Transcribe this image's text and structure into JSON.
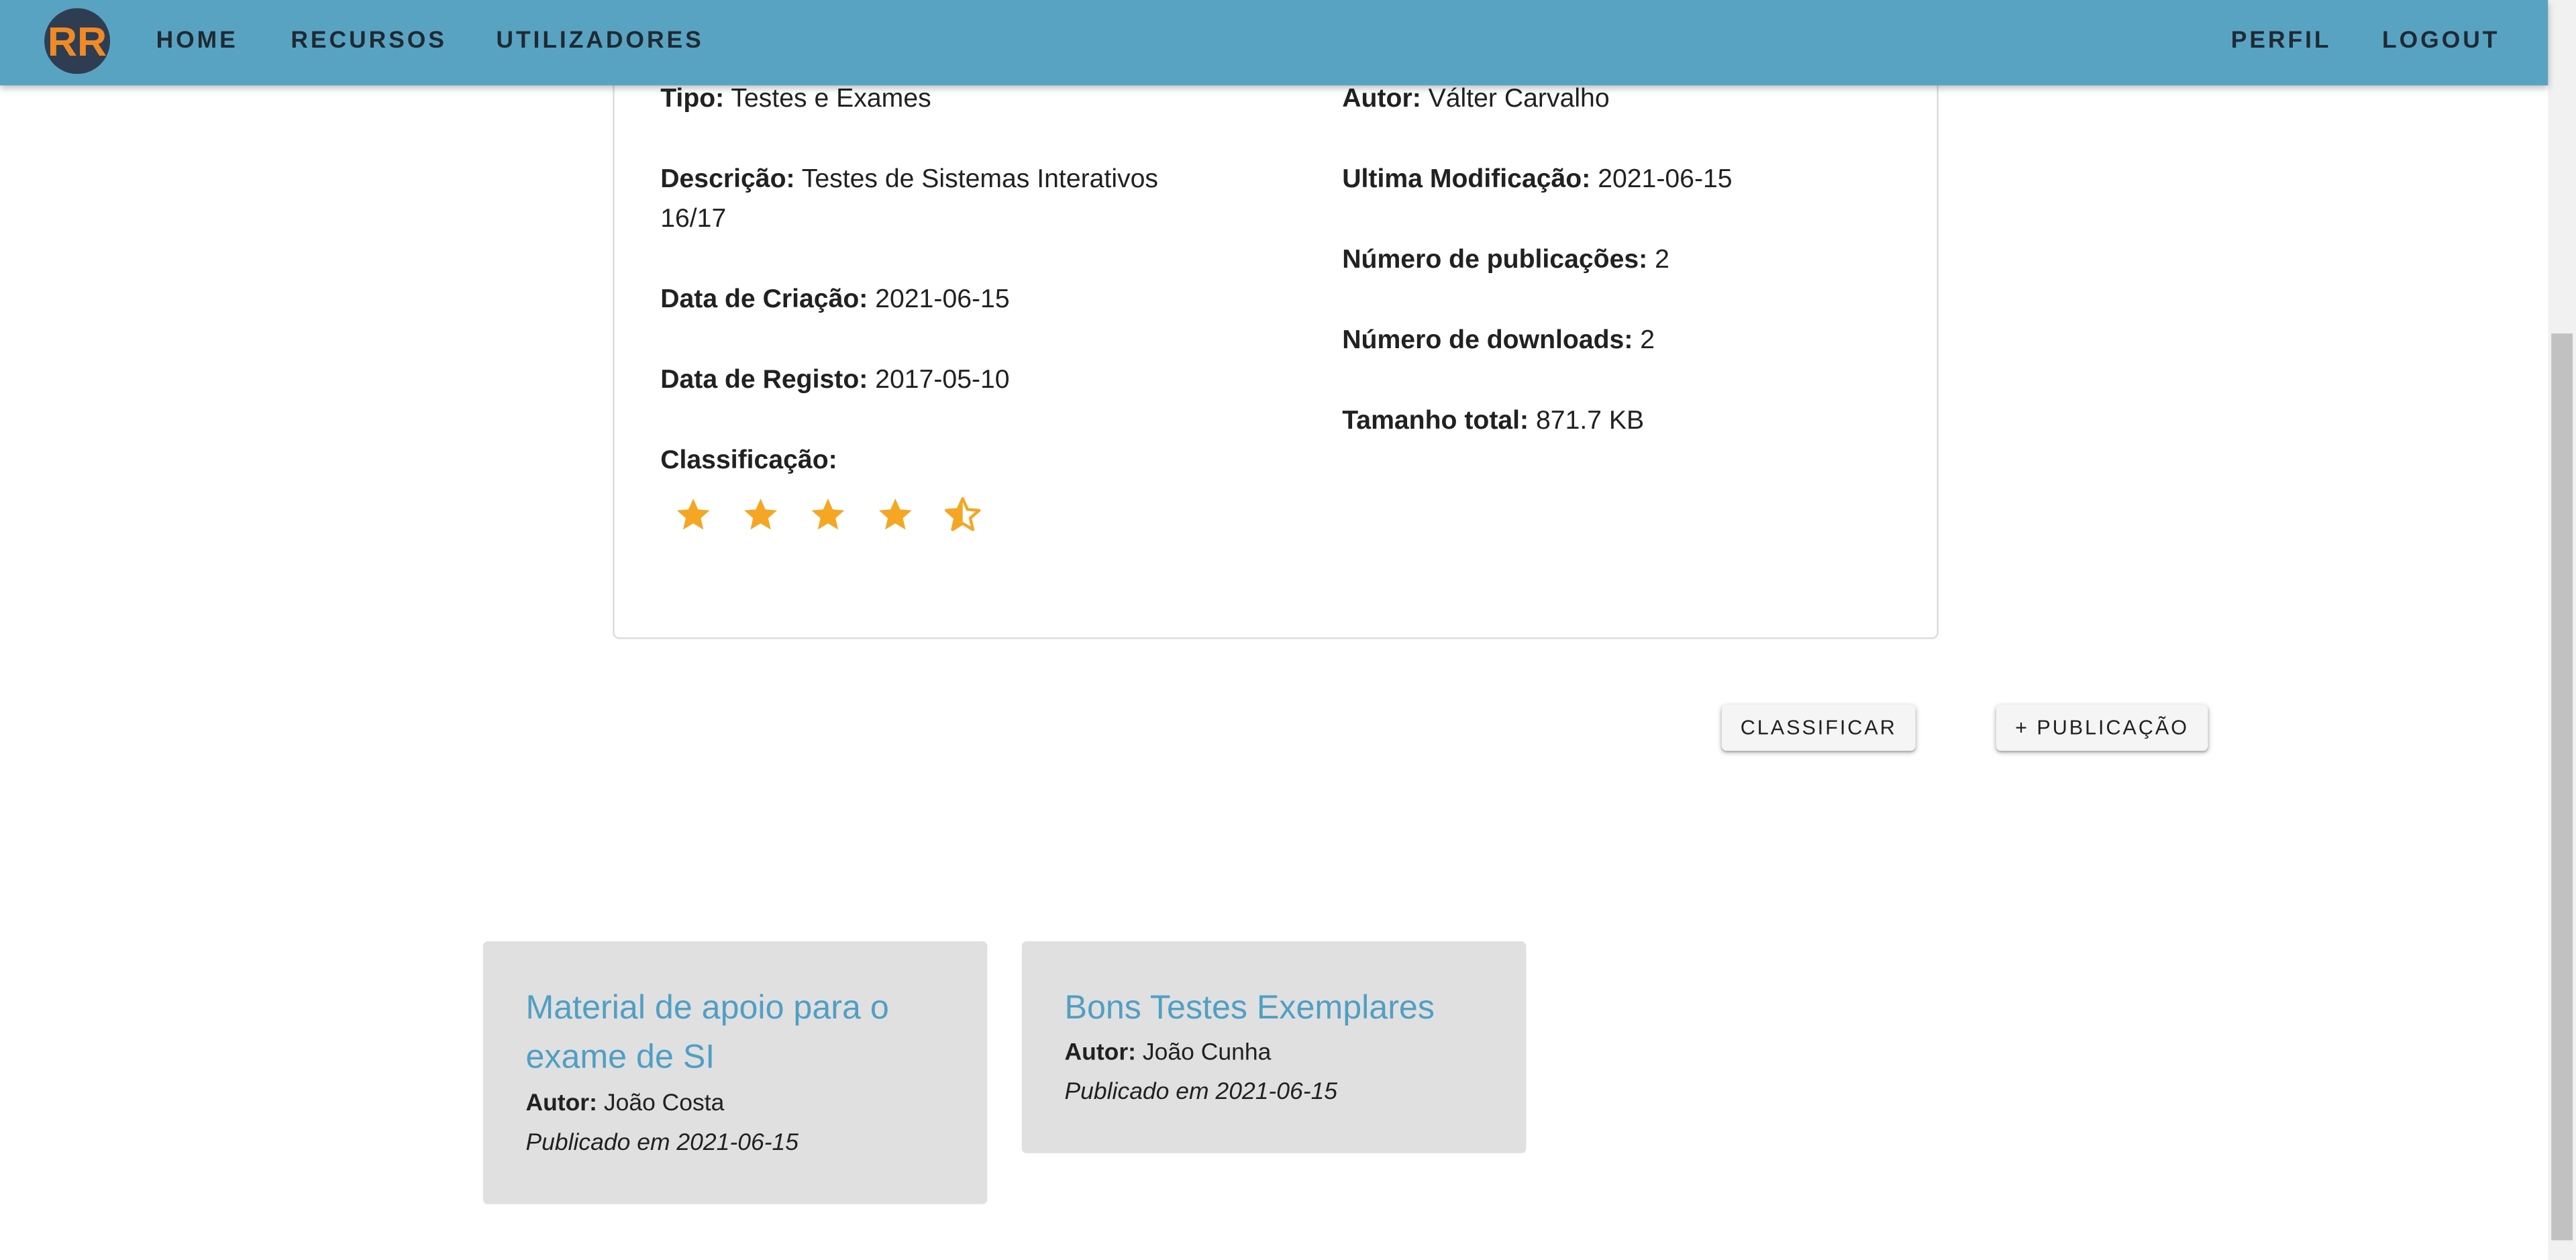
{
  "nav": {
    "logo_text": "RR",
    "items": [
      "HOME",
      "RECURSOS",
      "UTILIZADORES"
    ],
    "right_items": [
      "PERFIL",
      "LOGOUT"
    ]
  },
  "resource": {
    "left": [
      {
        "label": "Tipo:",
        "value": "Testes e Exames"
      },
      {
        "label": "Descrição:",
        "value": "Testes de Sistemas Interativos 16/17"
      },
      {
        "label": "Data de Criação:",
        "value": "2021-06-15"
      },
      {
        "label": "Data de Registo:",
        "value": "2017-05-10"
      },
      {
        "label": "Classificação:",
        "value": ""
      }
    ],
    "right": [
      {
        "label": "Autor:",
        "value": "Válter Carvalho"
      },
      {
        "label": "Ultima Modificação:",
        "value": "2021-06-15"
      },
      {
        "label": "Número de publicações:",
        "value": "2"
      },
      {
        "label": "Número de downloads:",
        "value": "2"
      },
      {
        "label": "Tamanho total:",
        "value": "871.7 KB"
      }
    ],
    "rating": {
      "value": 4.5,
      "max": 5,
      "color": "#f5a623"
    }
  },
  "buttons": {
    "classify": "CLASSIFICAR",
    "add_publication": "+ PUBLICAÇÃO"
  },
  "publications": [
    {
      "title": "Material de apoio para o exame de SI",
      "author_label": "Autor:",
      "author": "João Costa",
      "date_text": "Publicado em 2021-06-15"
    },
    {
      "title": "Bons Testes Exemplares",
      "author_label": "Autor:",
      "author": "João Cunha",
      "date_text": "Publicado em 2021-06-15"
    }
  ],
  "colors": {
    "navbar": "#59a3c2",
    "link": "#4f9fc4",
    "card_bg": "#e0e0e0",
    "star": "#f5a623",
    "logo_bg": "#2f3d52",
    "logo_fg": "#f08a24"
  }
}
